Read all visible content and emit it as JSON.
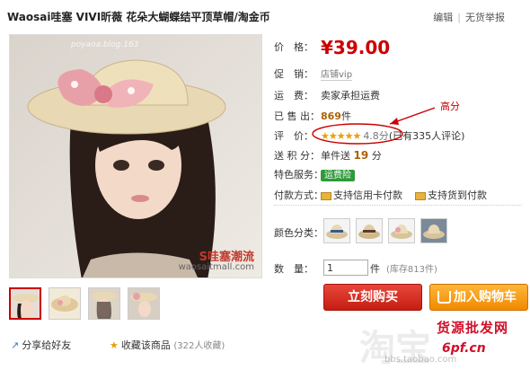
{
  "header": {
    "title": "Waosai哇塞 VIVI昕薇 花朵大蝴蝶结平顶草帽/淘金币",
    "edit_label": "编辑",
    "report_label": "无货举报"
  },
  "photo": {
    "watermark_top": "poyaoa.blog.163",
    "logo_text": "S哇塞潮流",
    "watermark_bottom": "waosaitmall.com"
  },
  "info": {
    "price_label": "价　格：",
    "price": "¥39.00",
    "promo_label": "促　销：",
    "promo_value": "店铺vip",
    "shipping_label": "运　费：",
    "shipping_value": "卖家承担运费",
    "sold_label": "已 售 出：",
    "sold_value": "869",
    "sold_unit": "件",
    "rating_label": "评　价：",
    "rating_stars": "★★★★★",
    "rating_score": "4.8分",
    "rating_reviews": "(已有335人评论)",
    "points_label": "送 积 分：",
    "points_prefix": "单件送",
    "points_value": "19",
    "points_unit": "分",
    "special_label": "特色服务：",
    "special_badge": "运费险",
    "payment_label": "付款方式：",
    "payment_credit": "支持信用卡付款",
    "payment_cod": "支持货到付款"
  },
  "options": {
    "color_label": "颜色分类：",
    "quantity_label": "数　量：",
    "quantity_value": "1",
    "quantity_unit": "件",
    "stock_text": "(库存813件)"
  },
  "actions": {
    "buy_now": "立刻购买",
    "add_to_cart": "加入购物车",
    "share": "分享给好友",
    "favorite": "收藏该商品",
    "favorite_count": "(322人收藏)"
  },
  "annotation": {
    "text": "高分"
  },
  "watermarks": {
    "taobao_big": "淘宝",
    "taobao_url": "bbs.taobao.com",
    "site_name": "货源批发网",
    "site_url": "6pf.cn"
  },
  "colors": {
    "price_red": "#cc0000",
    "buy_red": "#c41e10",
    "cart_orange": "#f08a00",
    "star_gold": "#e8a000"
  }
}
